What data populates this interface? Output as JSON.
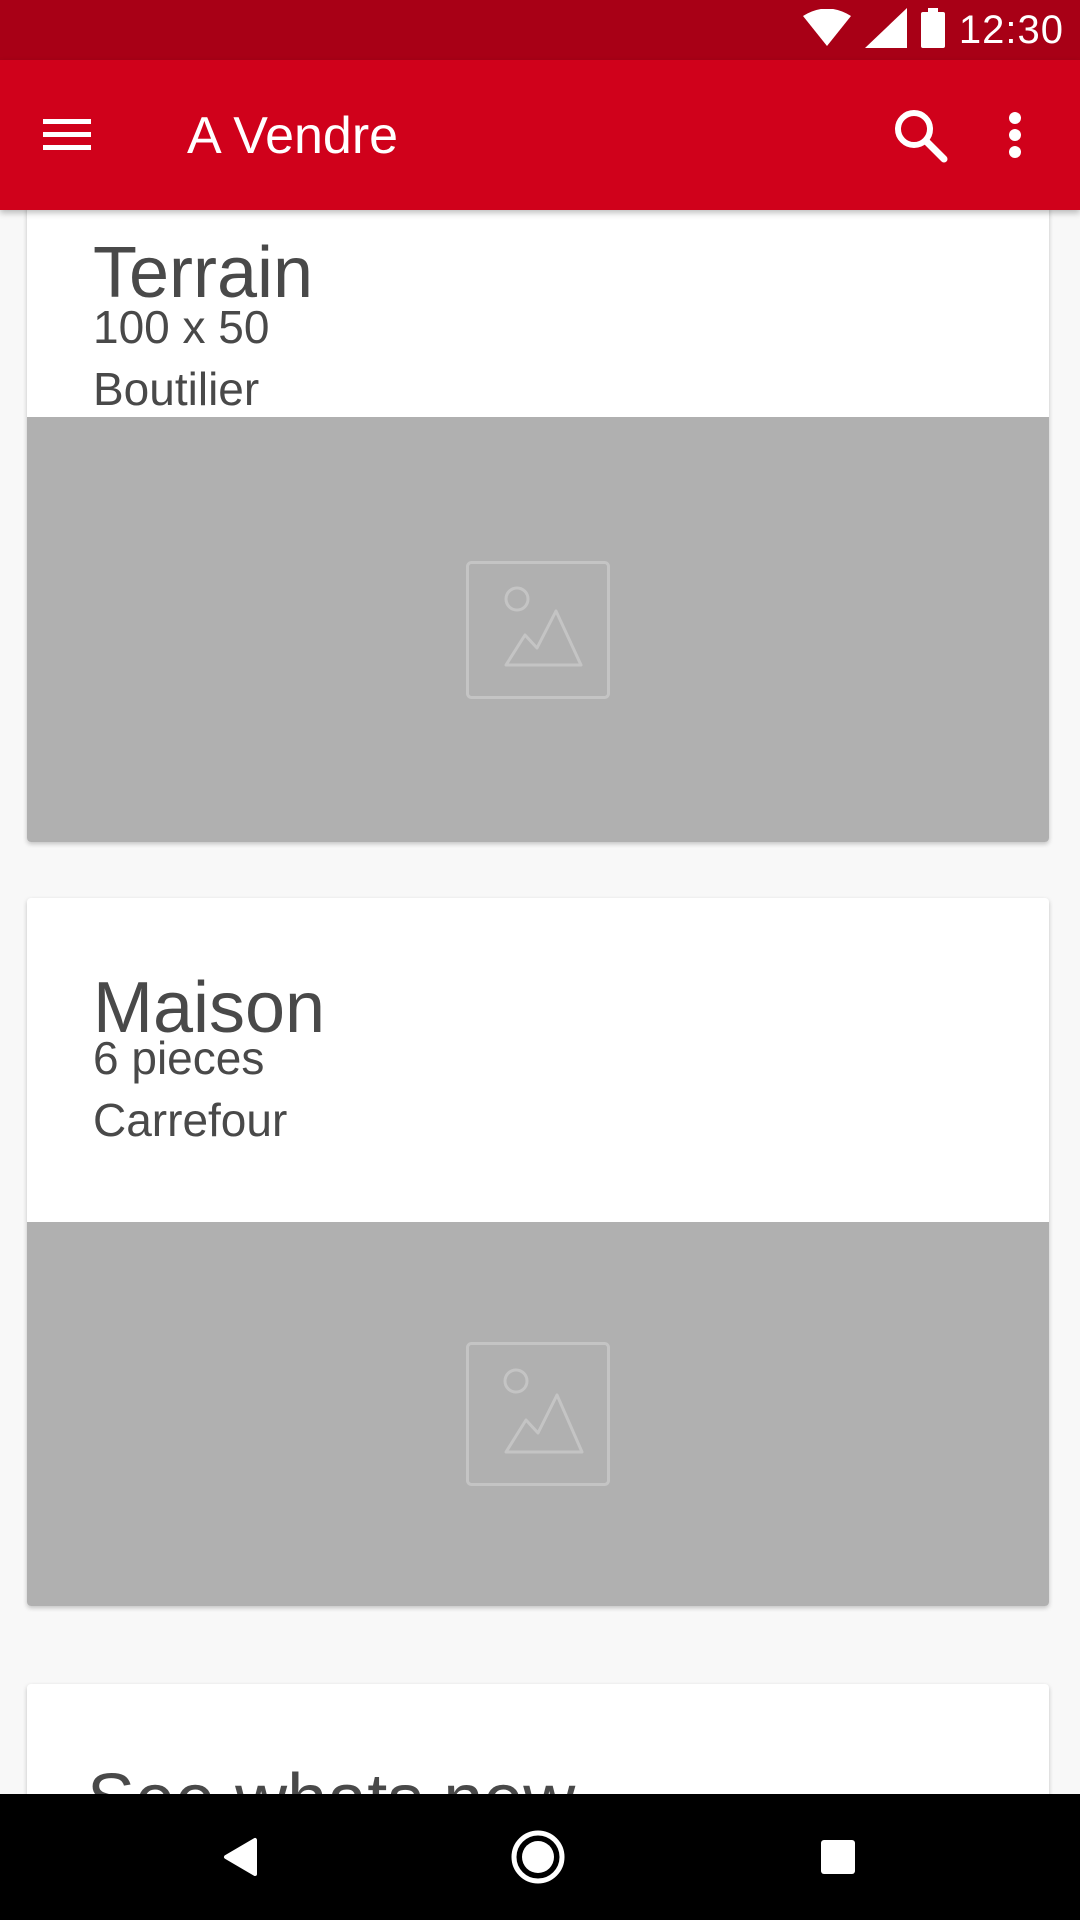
{
  "status_bar": {
    "time": "12:30",
    "icons": [
      "wifi-icon",
      "cell-signal-icon",
      "battery-icon"
    ]
  },
  "app_bar": {
    "title": "A Vendre",
    "icons": [
      "menu-icon",
      "search-icon",
      "more-vert-icon"
    ],
    "color": "#d0011b"
  },
  "listings": [
    {
      "title": "Terrain",
      "detail": "100 x 50",
      "location": "Boutilier",
      "image": "image-placeholder-icon"
    },
    {
      "title": "Maison",
      "detail": "6 pieces",
      "location": "Carrefour",
      "image": "image-placeholder-icon"
    },
    {
      "title": "See whats new"
    }
  ],
  "nav_bar": {
    "icons": [
      "back-icon",
      "home-icon",
      "recents-icon"
    ]
  },
  "colors": {
    "status_bar": "#a80016",
    "app_bar": "#d0011b",
    "background": "#f8f8f8",
    "image_placeholder": "#b0b0b0",
    "text": "#494949"
  }
}
